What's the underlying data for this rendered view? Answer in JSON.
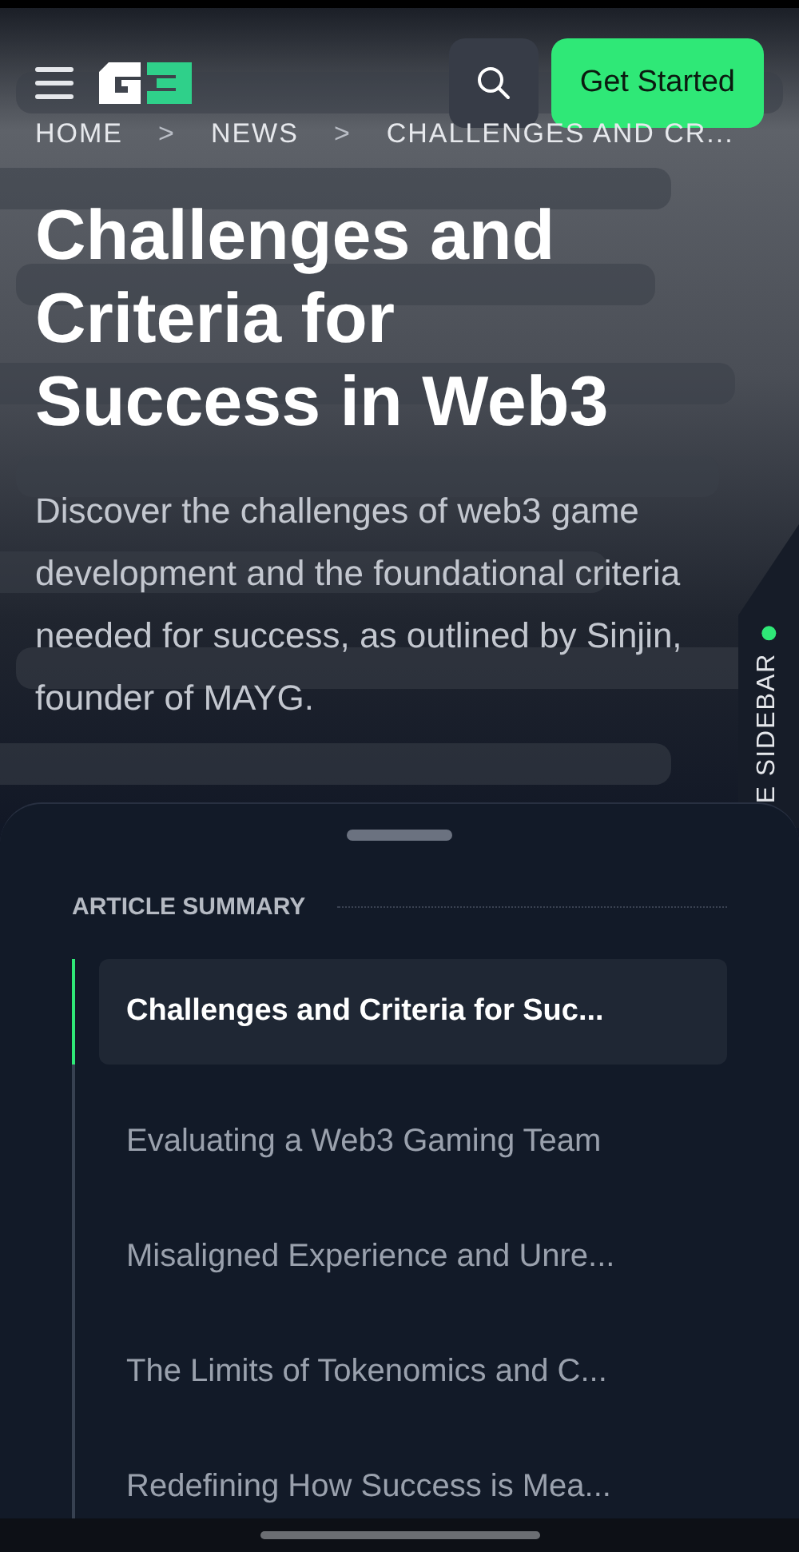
{
  "header": {
    "cta_button": {
      "label": "Get Started"
    }
  },
  "hero": {
    "breadcrumbs": [
      {
        "label": "HOME"
      },
      {
        "label": "NEWS"
      },
      {
        "label": "CHALLENGES AND CR..."
      }
    ],
    "breadcrumb_separator": ">",
    "title": "Challenges and Criteria for Success in Web3",
    "description": "Discover the challenges of web3 game development and the foundational criteria needed for success, as outlined by Sinjin, founder of MAYG."
  },
  "sidebar_tab": {
    "label": "E SIDEBAR",
    "online": true
  },
  "summary": {
    "heading": "ARTICLE SUMMARY",
    "items": [
      {
        "label": "Challenges and Criteria for Suc...",
        "selected": true
      },
      {
        "label": "Evaluating a Web3 Gaming Team",
        "selected": false
      },
      {
        "label": "Misaligned Experience and Unre...",
        "selected": false
      },
      {
        "label": "The Limits of Tokenomics and C...",
        "selected": false
      },
      {
        "label": "Redefining How Success is Mea...",
        "selected": false
      }
    ]
  }
}
